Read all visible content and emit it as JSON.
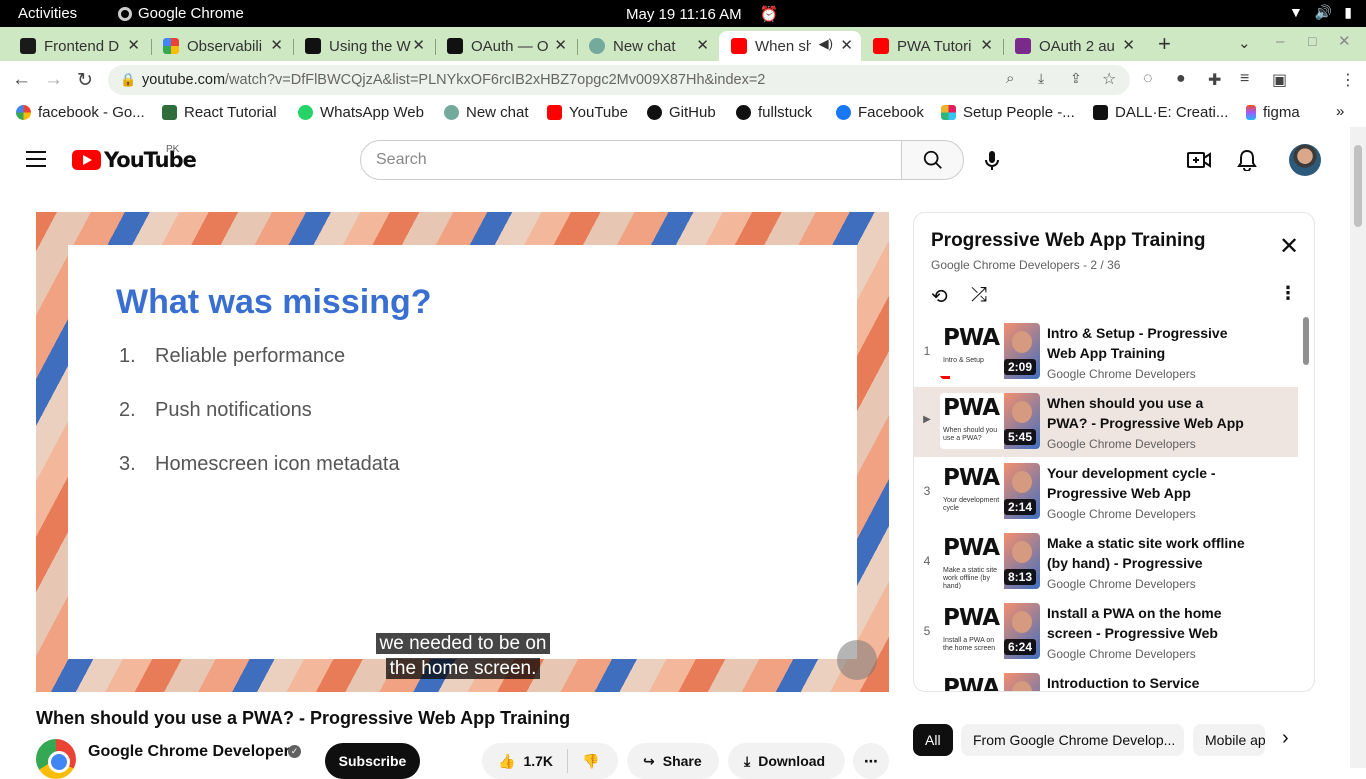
{
  "system": {
    "activities": "Activities",
    "app_name": "Google Chrome",
    "clock": "May 19  11:16 AM"
  },
  "tabs": [
    {
      "title": "Frontend D",
      "color": "#1a1a1a"
    },
    {
      "title": "Observabili",
      "color": "#e8a33a"
    },
    {
      "title": "Using the W",
      "color": "#111111"
    },
    {
      "title": "OAuth — O",
      "color": "#111111"
    },
    {
      "title": "New chat",
      "color": "#74aa9c"
    },
    {
      "title": "When sh",
      "color": "#ff0000"
    },
    {
      "title": "PWA Tutori",
      "color": "#ff0000"
    },
    {
      "title": "OAuth 2 au",
      "color": "#7a2a8a"
    }
  ],
  "omnibox": {
    "host": "youtube.com",
    "path": "/watch?v=DfFlBWCQjzA&list=PLNYkxOF6rcIB2xHBZ7opgc2Mv009X87Hh&index=2"
  },
  "bookmarks": [
    {
      "label": "facebook - Go...",
      "color": "#4285f4"
    },
    {
      "label": "React Tutorial",
      "color": "#2f6d3a"
    },
    {
      "label": "WhatsApp Web",
      "color": "#25d366"
    },
    {
      "label": "New chat",
      "color": "#74aa9c"
    },
    {
      "label": "YouTube",
      "color": "#ff0000"
    },
    {
      "label": "GitHub",
      "color": "#111111"
    },
    {
      "label": "fullstuck",
      "color": "#111111"
    },
    {
      "label": "Facebook",
      "color": "#1877f2"
    },
    {
      "label": "Setup People -...",
      "color": "#e94e3c"
    },
    {
      "label": "DALL·E: Creati...",
      "color": "#111111"
    },
    {
      "label": "figma",
      "color": "#a259ff"
    }
  ],
  "youtube": {
    "logo_word": "YouTube",
    "region": "PK",
    "search_placeholder": "Search"
  },
  "slide": {
    "title": "What was missing?",
    "items": [
      {
        "n": "1.",
        "text": "Reliable performance"
      },
      {
        "n": "2.",
        "text": "Push notifications"
      },
      {
        "n": "3.",
        "text": "Homescreen icon metadata"
      }
    ],
    "caption_line1": "we needed to be on",
    "caption_line2": "the home screen."
  },
  "video": {
    "title": "When should you use a PWA? - Progressive Web App Training",
    "channel": "Google Chrome Developers",
    "subscribe": "Subscribe",
    "likes": "1.7K",
    "share": "Share",
    "download": "Download"
  },
  "playlist": {
    "title": "Progressive Web App Training",
    "subtitle": "Google Chrome Developers - 2 / 36",
    "items": [
      {
        "index": "1",
        "title": "Intro & Setup - Progressive Web App Training",
        "channel": "Google Chrome Developers",
        "duration": "2:09",
        "thumb_caption": "Intro & Setup",
        "active": false
      },
      {
        "index": "▶",
        "title": "When should you use a PWA? - Progressive Web App Training",
        "channel": "Google Chrome Developers",
        "duration": "5:45",
        "thumb_caption": "When should you use a PWA?",
        "active": true
      },
      {
        "index": "3",
        "title": "Your development cycle - Progressive Web App Training",
        "channel": "Google Chrome Developers",
        "duration": "2:14",
        "thumb_caption": "Your development cycle",
        "active": false
      },
      {
        "index": "4",
        "title": "Make a static site work offline (by hand) - Progressive Web...",
        "channel": "Google Chrome Developers",
        "duration": "8:13",
        "thumb_caption": "Make a static site work offline (by hand)",
        "active": false
      },
      {
        "index": "5",
        "title": "Install a PWA on the home screen - Progressive Web Ap...",
        "channel": "Google Chrome Developers",
        "duration": "6:24",
        "thumb_caption": "Install a PWA on the home screen",
        "active": false
      },
      {
        "index": "",
        "title": "Introduction to Service Worker",
        "channel": "",
        "duration": "",
        "thumb_caption": "",
        "active": false
      }
    ]
  },
  "chips": [
    "All",
    "From Google Chrome Develop...",
    "Mobile ap"
  ]
}
